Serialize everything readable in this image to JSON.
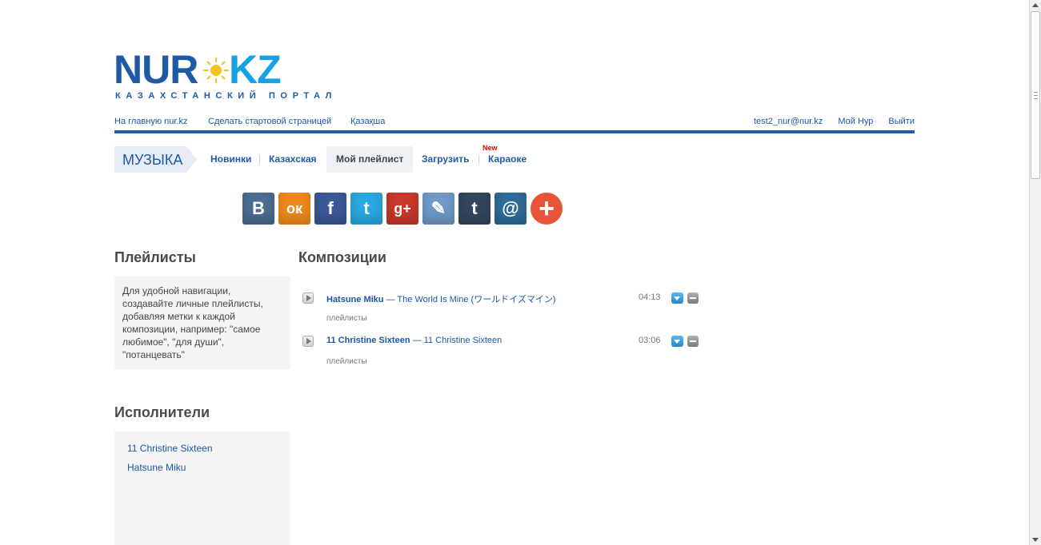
{
  "logo": {
    "nur": "NUR",
    "kz": "KZ",
    "subtitle": "КАЗАХСТАНСКИЙ ПОРТАЛ"
  },
  "topnav": {
    "home": "На главную nur.kz",
    "start_page": "Сделать стартовой страницей",
    "kazakh": "Қазақша",
    "user_email": "test2_nur@nur.kz",
    "my_nur": "Мой Нур",
    "logout": "Выйти"
  },
  "section": {
    "title": "МУЗЫКА",
    "menu": {
      "new": "Новинки",
      "kazakh": "Казахская",
      "my_playlist": "Мой плейлист",
      "upload": "Загрузить",
      "karaoke": "Караоке",
      "new_badge": "New",
      "separator": "|"
    }
  },
  "share": [
    {
      "name": "vkontakte-icon",
      "glyph": "В",
      "color": "#4b6d93"
    },
    {
      "name": "odnoklassniki-icon",
      "glyph": "ок",
      "color": "#f18a1c"
    },
    {
      "name": "facebook-icon",
      "glyph": "f",
      "color": "#3b5998"
    },
    {
      "name": "twitter-icon",
      "glyph": "t",
      "color": "#29a9e1"
    },
    {
      "name": "google-plus-icon",
      "glyph": "g+",
      "color": "#c9382a"
    },
    {
      "name": "livejournal-icon",
      "glyph": "✎",
      "color": "#6f9ac8"
    },
    {
      "name": "tumblr-icon",
      "glyph": "t",
      "color": "#34465d"
    },
    {
      "name": "mailru-icon",
      "glyph": "@",
      "color": "#2e6c9a"
    },
    {
      "name": "more-share-icon",
      "glyph": "+",
      "color": "#e8543a"
    }
  ],
  "playlists": {
    "heading": "Плейлисты",
    "info": "Для удобной навигации, создавайте личные плейлисты, добавляя метки к каждой композиции, например: \"самое любимое\", \"для души\", \"потанцевать\""
  },
  "artists": {
    "heading": "Исполнители",
    "items": [
      "11 Christine Sixteen",
      "Hatsune Miku"
    ]
  },
  "compositions": {
    "heading": "Композиции",
    "tracks": [
      {
        "artist": "Hatsune Miku",
        "title": " — The World Is Mine (ワールドイズマイン)",
        "duration": "04:13",
        "playlists": "плейлисты"
      },
      {
        "artist": "11 Christine Sixteen",
        "title": " — 11 Christine Sixteen",
        "duration": "03:06",
        "playlists": "плейлисты"
      }
    ]
  }
}
